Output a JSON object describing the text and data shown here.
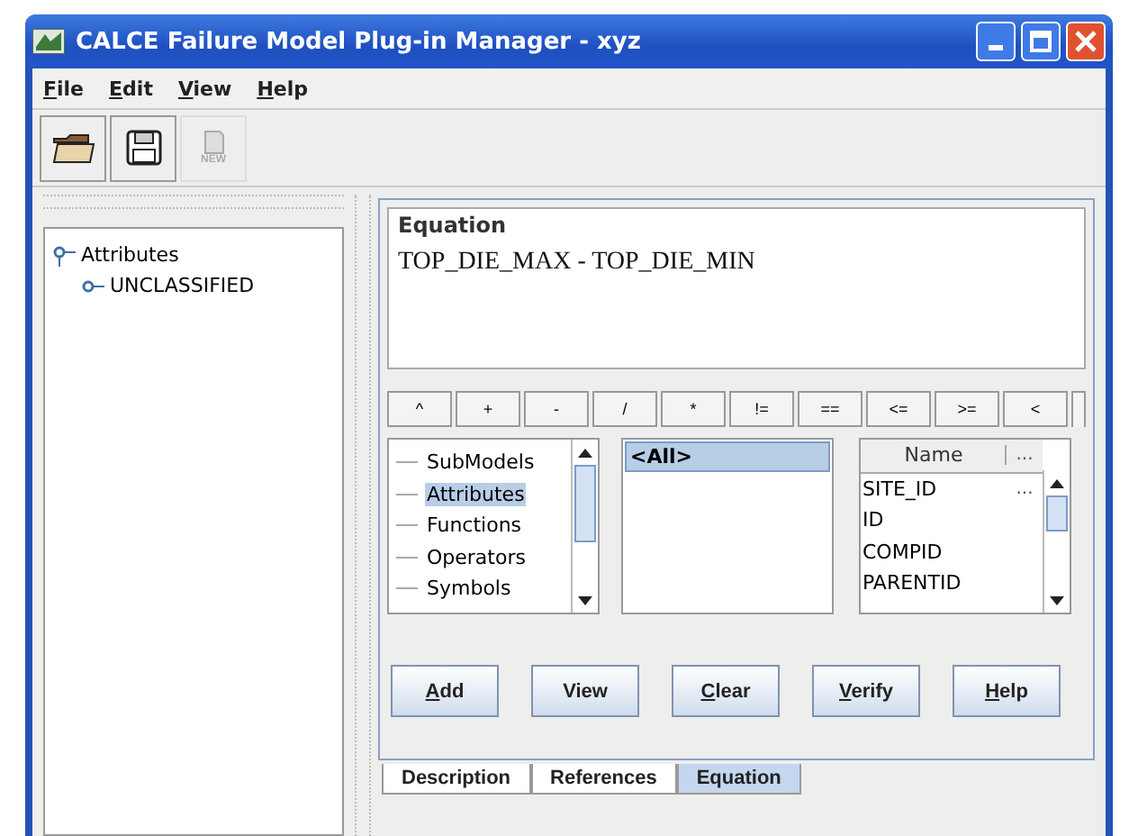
{
  "window": {
    "title": "CALCE Failure Model Plug-in Manager - xyz"
  },
  "menu": [
    {
      "label": "File",
      "mnemonic": true
    },
    {
      "label": "Edit",
      "mnemonic": true
    },
    {
      "label": "View",
      "mnemonic": true
    },
    {
      "label": "Help",
      "mnemonic": true
    }
  ],
  "toolbar": [
    {
      "kind": "open",
      "disabled": false
    },
    {
      "kind": "save",
      "disabled": false
    },
    {
      "kind": "new",
      "label": "NEW",
      "disabled": true
    }
  ],
  "tree": [
    {
      "label": "Attributes",
      "expanded": true,
      "children": [
        {
          "label": "UNCLASSIFIED",
          "expanded": false
        }
      ]
    }
  ],
  "equation": {
    "title": "Equation",
    "value": "TOP_DIE_MAX - TOP_DIE_MIN"
  },
  "operators": [
    "^",
    "+",
    "-",
    "/",
    "*",
    "!=",
    "==",
    "<=",
    ">=",
    "<"
  ],
  "categories": [
    {
      "label": "SubModels",
      "selected": false
    },
    {
      "label": "Attributes",
      "selected": true
    },
    {
      "label": "Functions",
      "selected": false
    },
    {
      "label": "Operators",
      "selected": false
    },
    {
      "label": "Symbols",
      "selected": false
    }
  ],
  "groups": [
    {
      "label": "<All>",
      "selected": true
    }
  ],
  "names": {
    "columns": [
      "Name",
      "..."
    ],
    "rows": [
      [
        "SITE_ID",
        "..."
      ],
      [
        "ID",
        ""
      ],
      [
        "COMPID",
        ""
      ],
      [
        "PARENTID",
        ""
      ]
    ]
  },
  "buttons": [
    {
      "label": "Add",
      "mnemonic": true
    },
    {
      "label": "View",
      "mnemonic": false
    },
    {
      "label": "Clear",
      "mnemonic": true
    },
    {
      "label": "Verify",
      "mnemonic": true
    },
    {
      "label": "Help",
      "mnemonic": true
    }
  ],
  "tabs": [
    {
      "label": "Description",
      "selected": false
    },
    {
      "label": "References",
      "selected": false
    },
    {
      "label": "Equation",
      "selected": true
    }
  ]
}
